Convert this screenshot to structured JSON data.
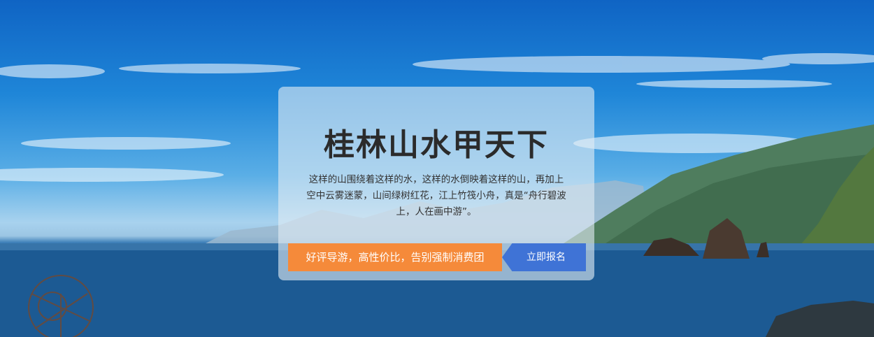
{
  "hero": {
    "title": "桂林山水甲天下",
    "description": "这样的山围绕着这样的水，这样的水倒映着这样的山，再加上空中云雾迷蒙，山间绿树红花，江上竹筏小舟，真是“舟行碧波上，人在画中游”。",
    "promo_text": "好评导游，高性价比，告别强制消费团",
    "cta_label": "立即报名",
    "colors": {
      "promo": "#f58a3a",
      "cta": "#3f73d6",
      "title": "#2b2b2b"
    }
  }
}
